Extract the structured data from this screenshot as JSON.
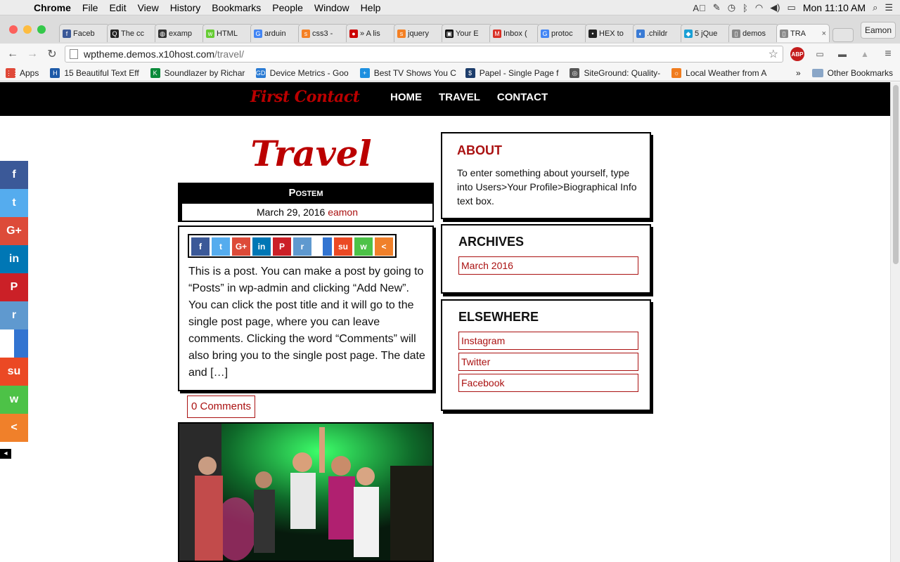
{
  "menubar": {
    "app": "Chrome",
    "items": [
      "File",
      "Edit",
      "View",
      "History",
      "Bookmarks",
      "People",
      "Window",
      "Help"
    ],
    "clock": "Mon 11:10 AM"
  },
  "tabs": [
    {
      "label": "Faceb",
      "fav": "f",
      "color": "#3b5998"
    },
    {
      "label": "The cc",
      "fav": "Q",
      "color": "#222"
    },
    {
      "label": "examp",
      "fav": "◍",
      "color": "#333"
    },
    {
      "label": "HTML",
      "fav": "w",
      "color": "#6c3"
    },
    {
      "label": "arduin",
      "fav": "G",
      "color": "#4285f4"
    },
    {
      "label": "css3 -",
      "fav": "s",
      "color": "#f48024"
    },
    {
      "label": "» A lis",
      "fav": "●",
      "color": "#c00"
    },
    {
      "label": "jquery",
      "fav": "s",
      "color": "#f48024"
    },
    {
      "label": "Your E",
      "fav": "▣",
      "color": "#111"
    },
    {
      "label": "Inbox (",
      "fav": "M",
      "color": "#d93025"
    },
    {
      "label": "protoc",
      "fav": "G",
      "color": "#4285f4"
    },
    {
      "label": "HEX to",
      "fav": "•",
      "color": "#222"
    },
    {
      "label": ".childr",
      "fav": "◐",
      "color": "#3a7bd5"
    },
    {
      "label": "5 jQue",
      "fav": "◆",
      "color": "#1a9fd5"
    },
    {
      "label": "demos",
      "fav": "▯",
      "color": "#888"
    },
    {
      "label": "TRA",
      "fav": "▯",
      "color": "#888",
      "active": true
    }
  ],
  "profile": "Eamon",
  "url": {
    "host": "wptheme.demos.x10host.com",
    "path": "/travel/"
  },
  "bookmarks": [
    {
      "label": "Apps",
      "fav": "⋮⋮",
      "color": "#e04a3a"
    },
    {
      "label": "15 Beautiful Text Eff",
      "fav": "H",
      "color": "#1e5aa8"
    },
    {
      "label": "Soundlazer by Richar",
      "fav": "K",
      "color": "#0a8a3a"
    },
    {
      "label": "Device Metrics - Goo",
      "fav": "GD",
      "color": "#2a7bd4"
    },
    {
      "label": "Best TV Shows You C",
      "fav": "+",
      "color": "#1e90e0"
    },
    {
      "label": "Papel - Single Page f",
      "fav": "$",
      "color": "#1d3d6b"
    },
    {
      "label": "SiteGround: Quality-",
      "fav": "◎",
      "color": "#555"
    },
    {
      "label": "Local Weather from A",
      "fav": "☼",
      "color": "#f07c1e"
    }
  ],
  "bookmarks_more": "»",
  "bookmarks_other": "Other Bookmarks",
  "site": {
    "logo": "First Contact",
    "nav": [
      "HOME",
      "TRAVEL",
      "CONTACT"
    ]
  },
  "page_title": "Travel",
  "post": {
    "title": "Postem",
    "date": "March 29, 2016",
    "author": "eamon",
    "excerpt": "This is a post. You can make a post by going to “Posts” in wp-admin and clicking “Add New”. You can click the post title and it will go to the single post page, where you can leave comments. Clicking the word “Comments” will also bring you to the single post page. The date and […]",
    "comments": "0 Comments"
  },
  "share_buttons": [
    {
      "name": "facebook",
      "glyph": "f",
      "color": "#3b5998"
    },
    {
      "name": "twitter",
      "glyph": "t",
      "color": "#55acee"
    },
    {
      "name": "googleplus",
      "glyph": "G+",
      "color": "#dd4b39"
    },
    {
      "name": "linkedin",
      "glyph": "in",
      "color": "#0077b5"
    },
    {
      "name": "pinterest",
      "glyph": "P",
      "color": "#cb2027"
    },
    {
      "name": "reddit",
      "glyph": "r",
      "color": "#5f99cf"
    },
    {
      "name": "delicious",
      "glyph": "",
      "color": "#3274d1"
    },
    {
      "name": "stumbleupon",
      "glyph": "su",
      "color": "#eb4924"
    },
    {
      "name": "whatsapp",
      "glyph": "w",
      "color": "#4dc247"
    },
    {
      "name": "share",
      "glyph": "<",
      "color": "#f0802a"
    }
  ],
  "widgets": {
    "about": {
      "title": "ABOUT",
      "text": "To enter something about yourself, type into Users>Your Profile>Biographical Info text box."
    },
    "archives": {
      "title": "ARCHIVES",
      "links": [
        "March 2016"
      ]
    },
    "elsewhere": {
      "title": "ELSEWHERE",
      "links": [
        "Instagram",
        "Twitter",
        "Facebook"
      ]
    }
  },
  "colors": {
    "accent": "#aa1111",
    "nav_bg": "#000000"
  }
}
